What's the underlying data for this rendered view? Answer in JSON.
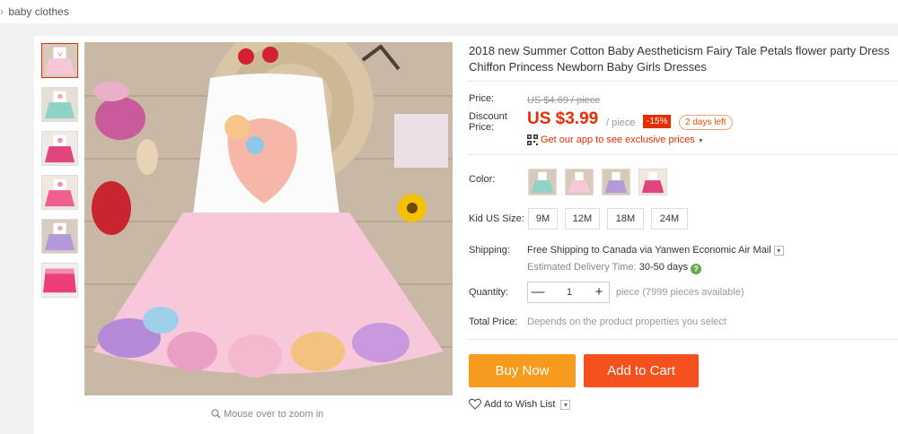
{
  "breadcrumb": {
    "separator": "›",
    "item": "baby clothes"
  },
  "product": {
    "title": "2018 new Summer Cotton Baby Aestheticism Fairy Tale Petals flower party Dress Chiffon Princess Newborn Baby Girls Dresses",
    "zoom_hint": "Mouse over to zoom in"
  },
  "pricing": {
    "price_label": "Price:",
    "original_price": "US $4.69 / piece",
    "discount_label": "Discount Price:",
    "discount_price": "US $3.99",
    "per_unit": "/ piece",
    "discount_pct": "-15%",
    "days_left": "2 days left",
    "app_promo": "Get our app to see exclusive prices",
    "app_caret": "▼"
  },
  "options": {
    "color_label": "Color:",
    "colors": [
      "mint",
      "pink-light",
      "purple",
      "rose"
    ],
    "size_label": "Kid US Size:",
    "sizes": [
      "9M",
      "12M",
      "18M",
      "24M"
    ]
  },
  "shipping": {
    "label": "Shipping:",
    "text": "Free Shipping to Canada via Yanwen Economic Air Mail",
    "dropdown_caret": "▾",
    "estimate_prefix": "Estimated Delivery Time:",
    "estimate_value": "30-50 days",
    "help_glyph": "?"
  },
  "quantity": {
    "label": "Quantity:",
    "minus": "—",
    "plus": "+",
    "value": "1",
    "availability": "piece (7999 pieces available)"
  },
  "total": {
    "label": "Total Price:",
    "value": "Depends on the product properties you select"
  },
  "actions": {
    "buy_now": "Buy Now",
    "add_to_cart": "Add to Cart",
    "wish_list": "Add to Wish List",
    "wish_caret": "▾"
  },
  "colors": {
    "accent": "#e62e04",
    "buy_now": "#f79b1e",
    "add_to_cart": "#f4511e"
  }
}
